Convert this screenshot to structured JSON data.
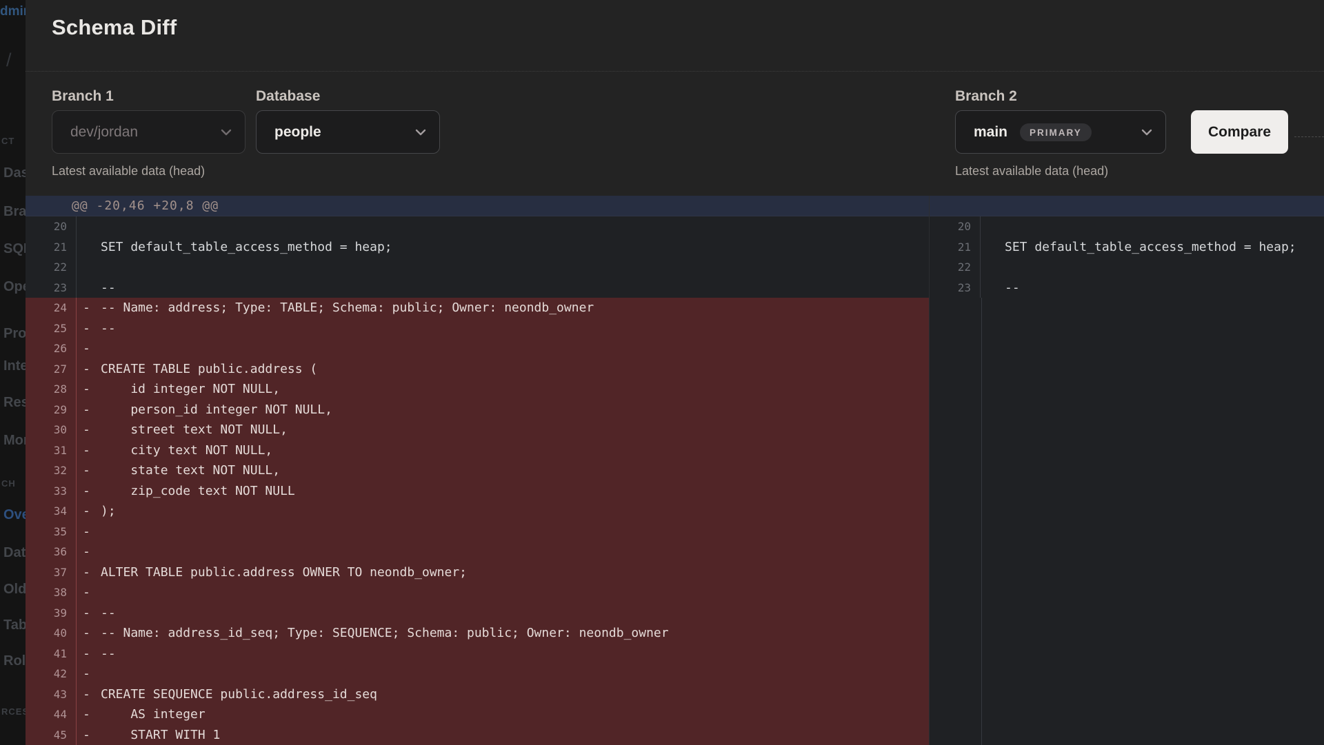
{
  "panel": {
    "title": "Schema Diff",
    "controls": {
      "branch1_label": "Branch 1",
      "branch1_value": "dev/jordan",
      "branch1_hint": "Latest available data (head)",
      "database_label": "Database",
      "database_value": "people",
      "branch2_label": "Branch 2",
      "branch2_value": "main",
      "branch2_badge": "PRIMARY",
      "branch2_hint": "Latest available data (head)",
      "compare_label": "Compare"
    }
  },
  "sidebar": {
    "fragments": [
      {
        "text": "dmin",
        "kind": "logo"
      },
      {
        "text": "/",
        "kind": "slash"
      },
      {
        "text": "CT",
        "kind": "section"
      },
      {
        "text": "Das",
        "kind": "item"
      },
      {
        "text": "Bra",
        "kind": "item"
      },
      {
        "text": "SQL",
        "kind": "item"
      },
      {
        "text": "Ope",
        "kind": "item"
      },
      {
        "text": "Pro",
        "kind": "item"
      },
      {
        "text": "Inte",
        "kind": "item"
      },
      {
        "text": "Res",
        "kind": "item"
      },
      {
        "text": "Mon",
        "kind": "item"
      },
      {
        "text": "CH",
        "kind": "section"
      },
      {
        "text": "Ove",
        "kind": "active"
      },
      {
        "text": "Dat",
        "kind": "item"
      },
      {
        "text": "Old",
        "kind": "item"
      },
      {
        "text": "Tab",
        "kind": "item"
      },
      {
        "text": "Rol",
        "kind": "item"
      },
      {
        "text": "RCES",
        "kind": "section"
      }
    ]
  },
  "diff": {
    "hunk_header": "@@ -20,46 +20,8 @@",
    "left_lines": [
      {
        "num": "20",
        "text": "",
        "removed": false
      },
      {
        "num": "21",
        "text": "SET default_table_access_method = heap;",
        "removed": false
      },
      {
        "num": "22",
        "text": "",
        "removed": false
      },
      {
        "num": "23",
        "text": "--",
        "removed": false
      },
      {
        "num": "24",
        "text": "-- Name: address; Type: TABLE; Schema: public; Owner: neondb_owner",
        "removed": true
      },
      {
        "num": "25",
        "text": "--",
        "removed": true
      },
      {
        "num": "26",
        "text": "",
        "removed": true
      },
      {
        "num": "27",
        "text": "CREATE TABLE public.address (",
        "removed": true
      },
      {
        "num": "28",
        "text": "    id integer NOT NULL,",
        "removed": true
      },
      {
        "num": "29",
        "text": "    person_id integer NOT NULL,",
        "removed": true
      },
      {
        "num": "30",
        "text": "    street text NOT NULL,",
        "removed": true
      },
      {
        "num": "31",
        "text": "    city text NOT NULL,",
        "removed": true
      },
      {
        "num": "32",
        "text": "    state text NOT NULL,",
        "removed": true
      },
      {
        "num": "33",
        "text": "    zip_code text NOT NULL",
        "removed": true
      },
      {
        "num": "34",
        "text": ");",
        "removed": true
      },
      {
        "num": "35",
        "text": "",
        "removed": true
      },
      {
        "num": "36",
        "text": "",
        "removed": true
      },
      {
        "num": "37",
        "text": "ALTER TABLE public.address OWNER TO neondb_owner;",
        "removed": true
      },
      {
        "num": "38",
        "text": "",
        "removed": true
      },
      {
        "num": "39",
        "text": "--",
        "removed": true
      },
      {
        "num": "40",
        "text": "-- Name: address_id_seq; Type: SEQUENCE; Schema: public; Owner: neondb_owner",
        "removed": true
      },
      {
        "num": "41",
        "text": "--",
        "removed": true
      },
      {
        "num": "42",
        "text": "",
        "removed": true
      },
      {
        "num": "43",
        "text": "CREATE SEQUENCE public.address_id_seq",
        "removed": true
      },
      {
        "num": "44",
        "text": "    AS integer",
        "removed": true
      },
      {
        "num": "45",
        "text": "    START WITH 1",
        "removed": true
      }
    ],
    "right_lines": [
      {
        "num": "20",
        "text": "",
        "removed": false
      },
      {
        "num": "21",
        "text": "SET default_table_access_method = heap;",
        "removed": false
      },
      {
        "num": "22",
        "text": "",
        "removed": false
      },
      {
        "num": "23",
        "text": "--",
        "removed": false
      }
    ]
  },
  "colors": {
    "panel_bg": "#232323",
    "removed_bg": "#512527",
    "hunk_bg": "#272e41",
    "compare_bg": "#f0eeec",
    "accent_blue": "#2d4f7e"
  }
}
